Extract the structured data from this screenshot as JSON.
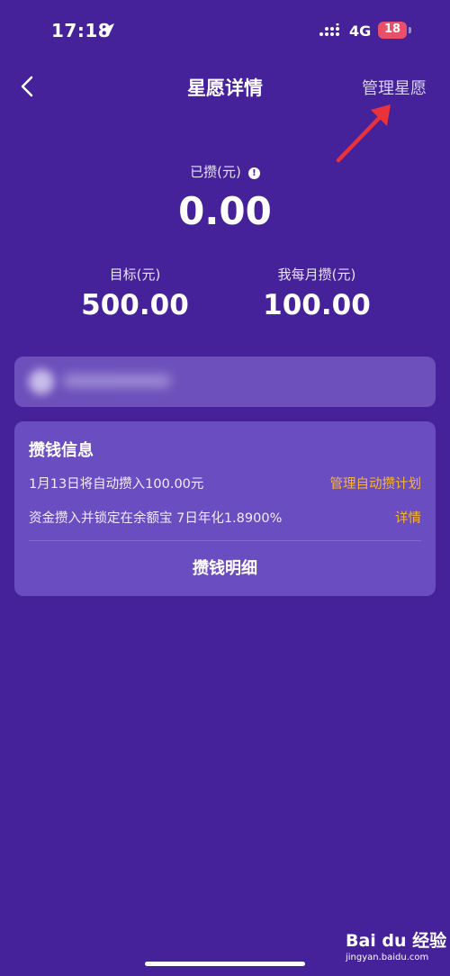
{
  "status_bar": {
    "time": "17:18",
    "network": "4G",
    "battery": "18"
  },
  "nav": {
    "title": "星愿详情",
    "manage_label": "管理星愿"
  },
  "summary": {
    "saved_label": "已攒(元)",
    "saved_value": "0.00",
    "target_label": "目标(元)",
    "target_value": "500.00",
    "monthly_label": "我每月攒(元)",
    "monthly_value": "100.00"
  },
  "info_card": {
    "title": "攒钱信息",
    "rows": [
      {
        "text": "1月13日将自动攒入100.00元",
        "link": "管理自动攒计划"
      },
      {
        "text": "资金攒入并锁定在余额宝 7日年化1.8900%",
        "link": "详情"
      }
    ],
    "details_button": "攒钱明细"
  },
  "watermark": {
    "logo": "Bai du 经验",
    "url": "jingyan.baidu.com"
  },
  "colors": {
    "background": "#45219a",
    "card": "#6a4dc0",
    "link": "#f6b536",
    "annotation_arrow": "#e8323c"
  },
  "icons": [
    "location-arrow-icon",
    "signal-icon",
    "battery-icon",
    "back-chevron-icon",
    "info-icon"
  ]
}
